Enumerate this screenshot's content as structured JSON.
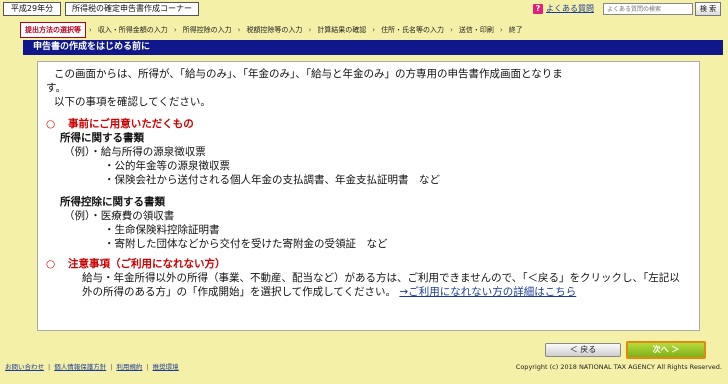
{
  "header": {
    "year": "平成29年分",
    "corner_title": "所得税の確定申告書作成コーナー",
    "faq_icon": "?",
    "faq_label": "よくある質問",
    "search_placeholder": "よくある質問の検索",
    "search_button": "検 索"
  },
  "steps": [
    {
      "label": "提出方法の選択等",
      "active": true
    },
    {
      "label": "収入・所得金額の入力"
    },
    {
      "label": "所得控除の入力"
    },
    {
      "label": "税額控除等の入力"
    },
    {
      "label": "計算結果の確認"
    },
    {
      "label": "住所・氏名等の入力"
    },
    {
      "label": "送信・印刷"
    },
    {
      "label": "終了"
    }
  ],
  "title": "申告書の作成をはじめる前に",
  "main": {
    "intro1": "この画面からは、所得が、「給与のみ」、「年金のみ」、「給与と年金のみ」の方専用の申告書作成画面となりま",
    "intro1b": "す。",
    "intro2": "以下の事項を確認してください。",
    "sec1_mark": "○",
    "sec1_title": "事前にご用意いただくもの",
    "income_head": "所得に関する書類",
    "income_items": [
      "（例）・給与所得の源泉徴収票",
      "・公的年金等の源泉徴収票",
      "・保険会社から送付される個人年金の支払調書、年金支払証明書　など"
    ],
    "deduction_head": "所得控除に関する書類",
    "deduction_items": [
      "（例）・医療費の領収書",
      "・生命保険料控除証明書",
      "・寄附した団体などから交付を受けた寄附金の受領証　など"
    ],
    "sec2_mark": "○",
    "sec2_title": "注意事項（ご利用になれない方）",
    "note_text": "給与・年金所得以外の所得（事業、不動産、配当など）がある方は、ご利用できませんので、「＜戻る」をクリックし、「左記以外の所得のある方」の「作成開始」を選択して作成してください。",
    "note_link": "→ご利用になれない方の詳細はこちら"
  },
  "buttons": {
    "back": "＜ 戻る",
    "next": "次へ ＞"
  },
  "footer": {
    "links": [
      "お問い合わせ",
      "個人情報保護方針",
      "利用規約",
      "推奨環境"
    ],
    "copyright": "Copyright (c) 2018 NATIONAL TAX AGENCY All Rights Reserved."
  },
  "colors": {
    "background": "#f5f0a8",
    "title_bar": "#10178a",
    "accent_red": "#cc0000",
    "next_button": "#8cc026"
  }
}
